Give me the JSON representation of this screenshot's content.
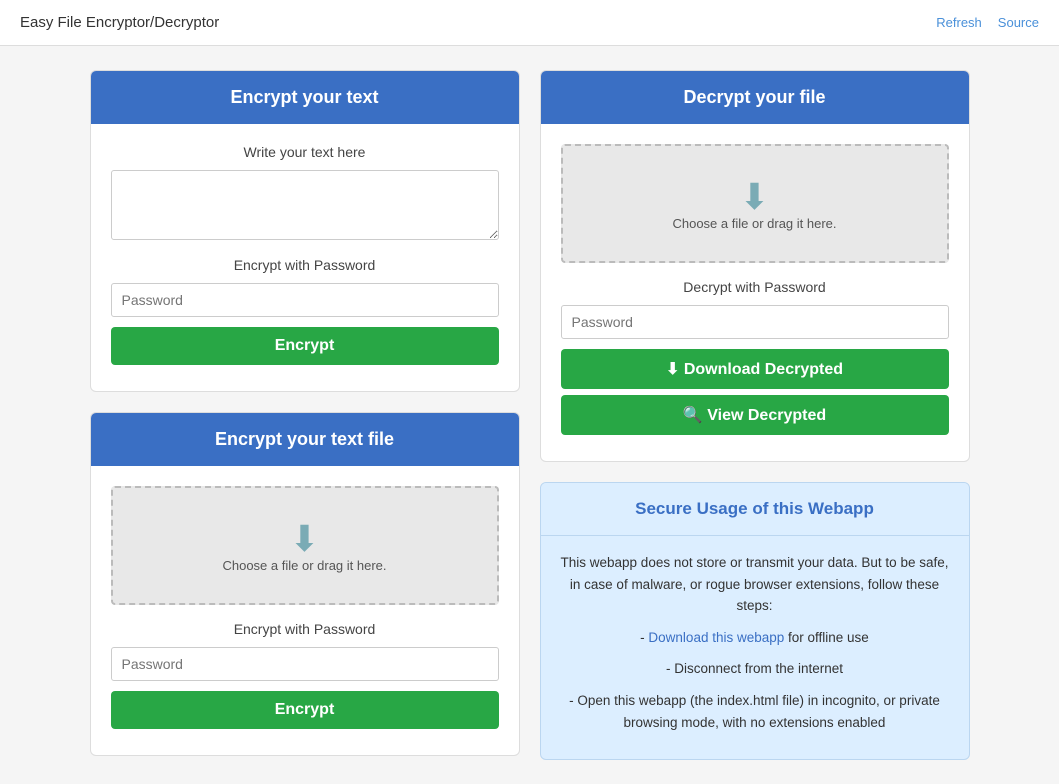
{
  "app": {
    "title": "Easy File Encryptor/Decryptor",
    "refresh_link": "Refresh",
    "source_link": "Source"
  },
  "encrypt_text": {
    "header": "Encrypt your text",
    "write_label": "Write your text here",
    "textarea_placeholder": "",
    "password_label": "Encrypt with Password",
    "password_placeholder": "Password",
    "encrypt_btn": "Encrypt"
  },
  "encrypt_file": {
    "header": "Encrypt your text file",
    "drop_label": "Choose a file or drag it here.",
    "password_label": "Encrypt with Password",
    "password_placeholder": "Password",
    "encrypt_btn": "Encrypt"
  },
  "decrypt_file": {
    "header": "Decrypt your file",
    "drop_label": "Choose a file or drag it here.",
    "password_label": "Decrypt with Password",
    "password_placeholder": "Password",
    "download_btn": "⬇ Download Decrypted",
    "view_btn": "🔍 View Decrypted"
  },
  "secure": {
    "header": "Secure Usage of this Webapp",
    "body": "This webapp does not store or transmit your data. But to be safe, in case of malware, or rogue browser extensions, follow these steps:",
    "step1_prefix": "- ",
    "step1_link": "Download this webapp",
    "step1_suffix": " for offline use",
    "step2": "- Disconnect from the internet",
    "step3": "- Open this webapp (the index.html file) in incognito, or private browsing mode, with no extensions enabled"
  }
}
